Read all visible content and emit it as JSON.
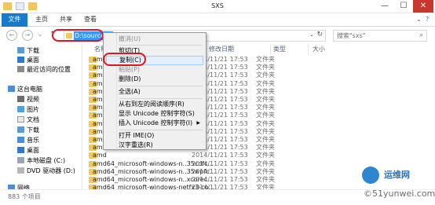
{
  "window": {
    "title": "SXS",
    "minimize": "—",
    "maximize": "☐",
    "close": "✕"
  },
  "ribbon": {
    "tabs": [
      "文件",
      "主页",
      "共享",
      "查看"
    ]
  },
  "address": {
    "path": "D:\\sources\\sxs",
    "search_placeholder": "搜索\"sxs\""
  },
  "sidebar": {
    "items": [
      "下载",
      "桌面",
      "最近访问的位置",
      "这台电脑",
      "视频",
      "图片",
      "文档",
      "下载",
      "音乐",
      "桌面",
      "本地磁盘 (C:)",
      "DVD 驱动器 (D:)",
      "网络"
    ]
  },
  "columns": {
    "name": "名称",
    "date": "修改日期",
    "type": "类型",
    "size": "大小"
  },
  "rows": [
    {
      "name": "amd",
      "date": "2014/11/21 17:53",
      "type": "文件夹"
    },
    {
      "name": "amd",
      "date": "2014/11/21 17:53",
      "type": "文件夹"
    },
    {
      "name": "amd",
      "date": "2014/11/21 17:53",
      "type": "文件夹"
    },
    {
      "name": "amd",
      "date": "2014/11/21 17:53",
      "type": "文件夹"
    },
    {
      "name": "amd",
      "date": "2014/11/21 17:53",
      "type": "文件夹"
    },
    {
      "name": "amd",
      "date": "2014/11/21 17:53",
      "type": "文件夹"
    },
    {
      "name": "amd",
      "date": "2014/11/21 17:53",
      "type": "文件夹"
    },
    {
      "name": "amd",
      "date": "2014/11/21 17:53",
      "type": "文件夹"
    },
    {
      "name": "amd",
      "date": "2014/11/21 17:53",
      "type": "文件夹"
    },
    {
      "name": "amd",
      "date": "2014/11/21 17:53",
      "type": "文件夹"
    },
    {
      "name": "amd",
      "date": "2014/11/21 17:53",
      "type": "文件夹"
    },
    {
      "name": "amd",
      "date": "2014/11/21 17:53",
      "type": "文件夹"
    },
    {
      "name": "amd",
      "date": "2014/11/21 17:53",
      "type": "文件夹"
    },
    {
      "name": "amd64_microsoft-windows-n..35cdfc...",
      "date": "2014/11/21 17:53",
      "type": "文件夹"
    },
    {
      "name": "amd64_microsoft-windows-n..35wpfc...",
      "date": "2014/11/21 17:53",
      "type": "文件夹"
    },
    {
      "name": "amd64_microsoft-windows-n..xcorec...",
      "date": "2014/11/21 17:53",
      "type": "文件夹"
    },
    {
      "name": "amd64_microsoft-windows-netfx3-co...",
      "date": "2014/11/21 17:53",
      "type": "文件夹"
    }
  ],
  "context_menu": {
    "undo": "撤消(U)",
    "cut": "剪切(T)",
    "copy": "复制(C)",
    "paste": "粘贴(P)",
    "delete": "删除(D)",
    "select_all": "全选(A)",
    "rtl": "从右到左的阅读顺序(R)",
    "show_unicode": "显示 Unicode 控制字符(S)",
    "insert_unicode": "插入 Unicode 控制字符(I)",
    "open_ime": "打开 IME(O)",
    "reconversion": "汉字重选(R)"
  },
  "status": {
    "count": "883 个项目"
  },
  "watermark": {
    "title": "运维网",
    "sub": "©51yunwei.com"
  },
  "colors": {
    "file_tab": "#1979ca",
    "selection": "#3399ff",
    "annotation_red": "#e0141e",
    "folder": "#f0c85b"
  }
}
